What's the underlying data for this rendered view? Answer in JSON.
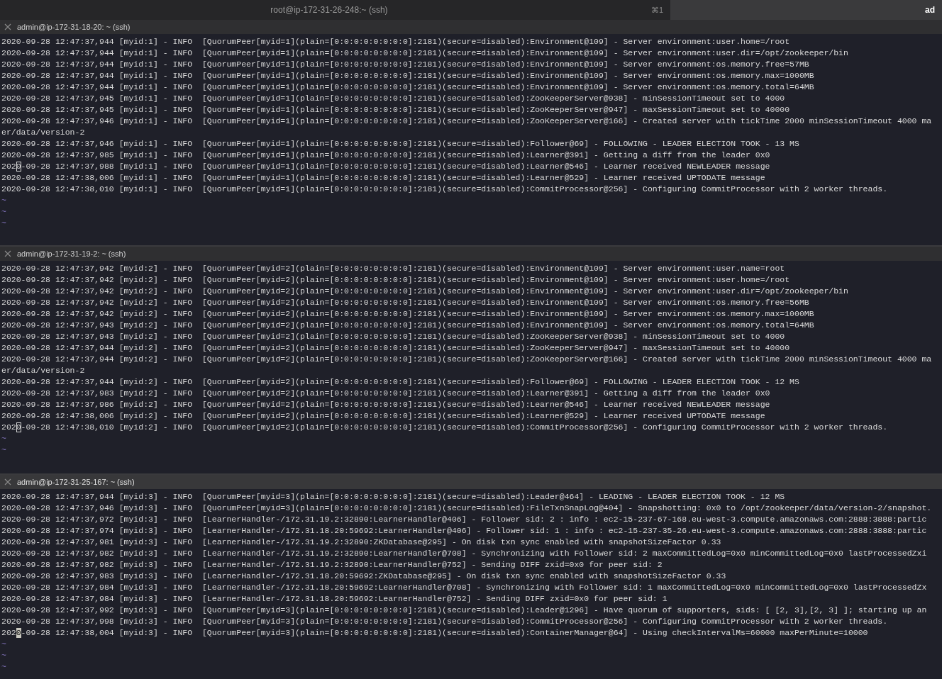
{
  "tabs": [
    {
      "label": "root@ip-172-31-26-248:~ (ssh)",
      "shortcut": "⌘1",
      "selected": false
    },
    {
      "label": "ad",
      "selected": true
    }
  ],
  "panes": [
    {
      "title": "admin@ip-172-31-18-20: ~ (ssh)",
      "focused": false,
      "lines": [
        {
          "text": "2020-09-28 12:47:37,944 [myid:1] - INFO  [QuorumPeer[myid=1](plain=[0:0:0:0:0:0:0:0]:2181)(secure=disabled):Environment@109] - Server environment:user.home=/root",
          "cursor": false
        },
        {
          "text": "2020-09-28 12:47:37,944 [myid:1] - INFO  [QuorumPeer[myid=1](plain=[0:0:0:0:0:0:0:0]:2181)(secure=disabled):Environment@109] - Server environment:user.dir=/opt/zookeeper/bin",
          "cursor": false
        },
        {
          "text": "2020-09-28 12:47:37,944 [myid:1] - INFO  [QuorumPeer[myid=1](plain=[0:0:0:0:0:0:0:0]:2181)(secure=disabled):Environment@109] - Server environment:os.memory.free=57MB",
          "cursor": false
        },
        {
          "text": "2020-09-28 12:47:37,944 [myid:1] - INFO  [QuorumPeer[myid=1](plain=[0:0:0:0:0:0:0:0]:2181)(secure=disabled):Environment@109] - Server environment:os.memory.max=1000MB",
          "cursor": false
        },
        {
          "text": "2020-09-28 12:47:37,944 [myid:1] - INFO  [QuorumPeer[myid=1](plain=[0:0:0:0:0:0:0:0]:2181)(secure=disabled):Environment@109] - Server environment:os.memory.total=64MB",
          "cursor": false
        },
        {
          "text": "2020-09-28 12:47:37,945 [myid:1] - INFO  [QuorumPeer[myid=1](plain=[0:0:0:0:0:0:0:0]:2181)(secure=disabled):ZooKeeperServer@938] - minSessionTimeout set to 4000",
          "cursor": false
        },
        {
          "text": "2020-09-28 12:47:37,945 [myid:1] - INFO  [QuorumPeer[myid=1](plain=[0:0:0:0:0:0:0:0]:2181)(secure=disabled):ZooKeeperServer@947] - maxSessionTimeout set to 40000",
          "cursor": false
        },
        {
          "text": "2020-09-28 12:47:37,946 [myid:1] - INFO  [QuorumPeer[myid=1](plain=[0:0:0:0:0:0:0:0]:2181)(secure=disabled):ZooKeeperServer@166] - Created server with tickTime 2000 minSessionTimeout 4000 ma",
          "cursor": false
        },
        {
          "text": "er/data/version-2",
          "cursor": false
        },
        {
          "text": "2020-09-28 12:47:37,946 [myid:1] - INFO  [QuorumPeer[myid=1](plain=[0:0:0:0:0:0:0:0]:2181)(secure=disabled):Follower@69] - FOLLOWING - LEADER ELECTION TOOK - 13 MS",
          "cursor": false
        },
        {
          "text": "2020-09-28 12:47:37,985 [myid:1] - INFO  [QuorumPeer[myid=1](plain=[0:0:0:0:0:0:0:0]:2181)(secure=disabled):Learner@391] - Getting a diff from the leader 0x0",
          "cursor": false
        },
        {
          "text": "2020-09-28 12:47:37,988 [myid:1] - INFO  [QuorumPeer[myid=1](plain=[0:0:0:0:0:0:0:0]:2181)(secure=disabled):Learner@546] - Learner received NEWLEADER message",
          "cursor": true
        },
        {
          "text": "2020-09-28 12:47:38,006 [myid:1] - INFO  [QuorumPeer[myid=1](plain=[0:0:0:0:0:0:0:0]:2181)(secure=disabled):Learner@529] - Learner received UPTODATE message",
          "cursor": false
        },
        {
          "text": "2020-09-28 12:47:38,010 [myid:1] - INFO  [QuorumPeer[myid=1](plain=[0:0:0:0:0:0:0:0]:2181)(secure=disabled):CommitProcessor@256] - Configuring CommitProcessor with 2 worker threads.",
          "cursor": false
        }
      ],
      "empty_lines": [
        "~",
        "~",
        "~"
      ]
    },
    {
      "title": "admin@ip-172-31-19-2: ~ (ssh)",
      "focused": false,
      "lines": [
        {
          "text": "2020-09-28 12:47:37,942 [myid:2] - INFO  [QuorumPeer[myid=2](plain=[0:0:0:0:0:0:0:0]:2181)(secure=disabled):Environment@109] - Server environment:user.name=root",
          "cursor": false
        },
        {
          "text": "2020-09-28 12:47:37,942 [myid:2] - INFO  [QuorumPeer[myid=2](plain=[0:0:0:0:0:0:0:0]:2181)(secure=disabled):Environment@109] - Server environment:user.home=/root",
          "cursor": false
        },
        {
          "text": "2020-09-28 12:47:37,942 [myid:2] - INFO  [QuorumPeer[myid=2](plain=[0:0:0:0:0:0:0:0]:2181)(secure=disabled):Environment@109] - Server environment:user.dir=/opt/zookeeper/bin",
          "cursor": false
        },
        {
          "text": "2020-09-28 12:47:37,942 [myid:2] - INFO  [QuorumPeer[myid=2](plain=[0:0:0:0:0:0:0:0]:2181)(secure=disabled):Environment@109] - Server environment:os.memory.free=56MB",
          "cursor": false
        },
        {
          "text": "2020-09-28 12:47:37,942 [myid:2] - INFO  [QuorumPeer[myid=2](plain=[0:0:0:0:0:0:0:0]:2181)(secure=disabled):Environment@109] - Server environment:os.memory.max=1000MB",
          "cursor": false
        },
        {
          "text": "2020-09-28 12:47:37,943 [myid:2] - INFO  [QuorumPeer[myid=2](plain=[0:0:0:0:0:0:0:0]:2181)(secure=disabled):Environment@109] - Server environment:os.memory.total=64MB",
          "cursor": false
        },
        {
          "text": "2020-09-28 12:47:37,943 [myid:2] - INFO  [QuorumPeer[myid=2](plain=[0:0:0:0:0:0:0:0]:2181)(secure=disabled):ZooKeeperServer@938] - minSessionTimeout set to 4000",
          "cursor": false
        },
        {
          "text": "2020-09-28 12:47:37,944 [myid:2] - INFO  [QuorumPeer[myid=2](plain=[0:0:0:0:0:0:0:0]:2181)(secure=disabled):ZooKeeperServer@947] - maxSessionTimeout set to 40000",
          "cursor": false
        },
        {
          "text": "2020-09-28 12:47:37,944 [myid:2] - INFO  [QuorumPeer[myid=2](plain=[0:0:0:0:0:0:0:0]:2181)(secure=disabled):ZooKeeperServer@166] - Created server with tickTime 2000 minSessionTimeout 4000 ma",
          "cursor": false
        },
        {
          "text": "er/data/version-2",
          "cursor": false
        },
        {
          "text": "2020-09-28 12:47:37,944 [myid:2] - INFO  [QuorumPeer[myid=2](plain=[0:0:0:0:0:0:0:0]:2181)(secure=disabled):Follower@69] - FOLLOWING - LEADER ELECTION TOOK - 12 MS",
          "cursor": false
        },
        {
          "text": "2020-09-28 12:47:37,983 [myid:2] - INFO  [QuorumPeer[myid=2](plain=[0:0:0:0:0:0:0:0]:2181)(secure=disabled):Learner@391] - Getting a diff from the leader 0x0",
          "cursor": false
        },
        {
          "text": "2020-09-28 12:47:37,986 [myid:2] - INFO  [QuorumPeer[myid=2](plain=[0:0:0:0:0:0:0:0]:2181)(secure=disabled):Learner@546] - Learner received NEWLEADER message",
          "cursor": false
        },
        {
          "text": "2020-09-28 12:47:38,006 [myid:2] - INFO  [QuorumPeer[myid=2](plain=[0:0:0:0:0:0:0:0]:2181)(secure=disabled):Learner@529] - Learner received UPTODATE message",
          "cursor": false
        },
        {
          "text": "2020-09-28 12:47:38,010 [myid:2] - INFO  [QuorumPeer[myid=2](plain=[0:0:0:0:0:0:0:0]:2181)(secure=disabled):CommitProcessor@256] - Configuring CommitProcessor with 2 worker threads.",
          "cursor": true
        }
      ],
      "empty_lines": [
        "~",
        "~"
      ]
    },
    {
      "title": "admin@ip-172-31-25-167: ~ (ssh)",
      "focused": true,
      "lines": [
        {
          "text": "2020-09-28 12:47:37,944 [myid:3] - INFO  [QuorumPeer[myid=3](plain=[0:0:0:0:0:0:0:0]:2181)(secure=disabled):Leader@464] - LEADING - LEADER ELECTION TOOK - 12 MS",
          "cursor": false
        },
        {
          "text": "2020-09-28 12:47:37,946 [myid:3] - INFO  [QuorumPeer[myid=3](plain=[0:0:0:0:0:0:0:0]:2181)(secure=disabled):FileTxnSnapLog@404] - Snapshotting: 0x0 to /opt/zookeeper/data/version-2/snapshot.",
          "cursor": false
        },
        {
          "text": "2020-09-28 12:47:37,972 [myid:3] - INFO  [LearnerHandler-/172.31.19.2:32890:LearnerHandler@406] - Follower sid: 2 : info : ec2-15-237-67-168.eu-west-3.compute.amazonaws.com:2888:3888:partic",
          "cursor": false
        },
        {
          "text": "2020-09-28 12:47:37,974 [myid:3] - INFO  [LearnerHandler-/172.31.18.20:59692:LearnerHandler@406] - Follower sid: 1 : info : ec2-15-237-35-26.eu-west-3.compute.amazonaws.com:2888:3888:partic",
          "cursor": false
        },
        {
          "text": "2020-09-28 12:47:37,981 [myid:3] - INFO  [LearnerHandler-/172.31.19.2:32890:ZKDatabase@295] - On disk txn sync enabled with snapshotSizeFactor 0.33",
          "cursor": false
        },
        {
          "text": "2020-09-28 12:47:37,982 [myid:3] - INFO  [LearnerHandler-/172.31.19.2:32890:LearnerHandler@708] - Synchronizing with Follower sid: 2 maxCommittedLog=0x0 minCommittedLog=0x0 lastProcessedZxi",
          "cursor": false
        },
        {
          "text": "2020-09-28 12:47:37,982 [myid:3] - INFO  [LearnerHandler-/172.31.19.2:32890:LearnerHandler@752] - Sending DIFF zxid=0x0 for peer sid: 2",
          "cursor": false
        },
        {
          "text": "2020-09-28 12:47:37,983 [myid:3] - INFO  [LearnerHandler-/172.31.18.20:59692:ZKDatabase@295] - On disk txn sync enabled with snapshotSizeFactor 0.33",
          "cursor": false
        },
        {
          "text": "2020-09-28 12:47:37,984 [myid:3] - INFO  [LearnerHandler-/172.31.18.20:59692:LearnerHandler@708] - Synchronizing with Follower sid: 1 maxCommittedLog=0x0 minCommittedLog=0x0 lastProcessedZx",
          "cursor": false
        },
        {
          "text": "2020-09-28 12:47:37,984 [myid:3] - INFO  [LearnerHandler-/172.31.18.20:59692:LearnerHandler@752] - Sending DIFF zxid=0x0 for peer sid: 1",
          "cursor": false
        },
        {
          "text": "2020-09-28 12:47:37,992 [myid:3] - INFO  [QuorumPeer[myid=3](plain=[0:0:0:0:0:0:0:0]:2181)(secure=disabled):Leader@1296] - Have quorum of supporters, sids: [ [2, 3],[2, 3] ]; starting up an",
          "cursor": false
        },
        {
          "text": "2020-09-28 12:47:37,998 [myid:3] - INFO  [QuorumPeer[myid=3](plain=[0:0:0:0:0:0:0:0]:2181)(secure=disabled):CommitProcessor@256] - Configuring CommitProcessor with 2 worker threads.",
          "cursor": false
        },
        {
          "text": "2020-09-28 12:47:38,004 [myid:3] - INFO  [QuorumPeer[myid=3](plain=[0:0:0:0:0:0:0:0]:2181)(secure=disabled):ContainerManager@64] - Using checkIntervalMs=60000 maxPerMinute=10000",
          "cursor": true
        }
      ],
      "empty_lines": [
        "~",
        "~",
        "~"
      ]
    }
  ]
}
